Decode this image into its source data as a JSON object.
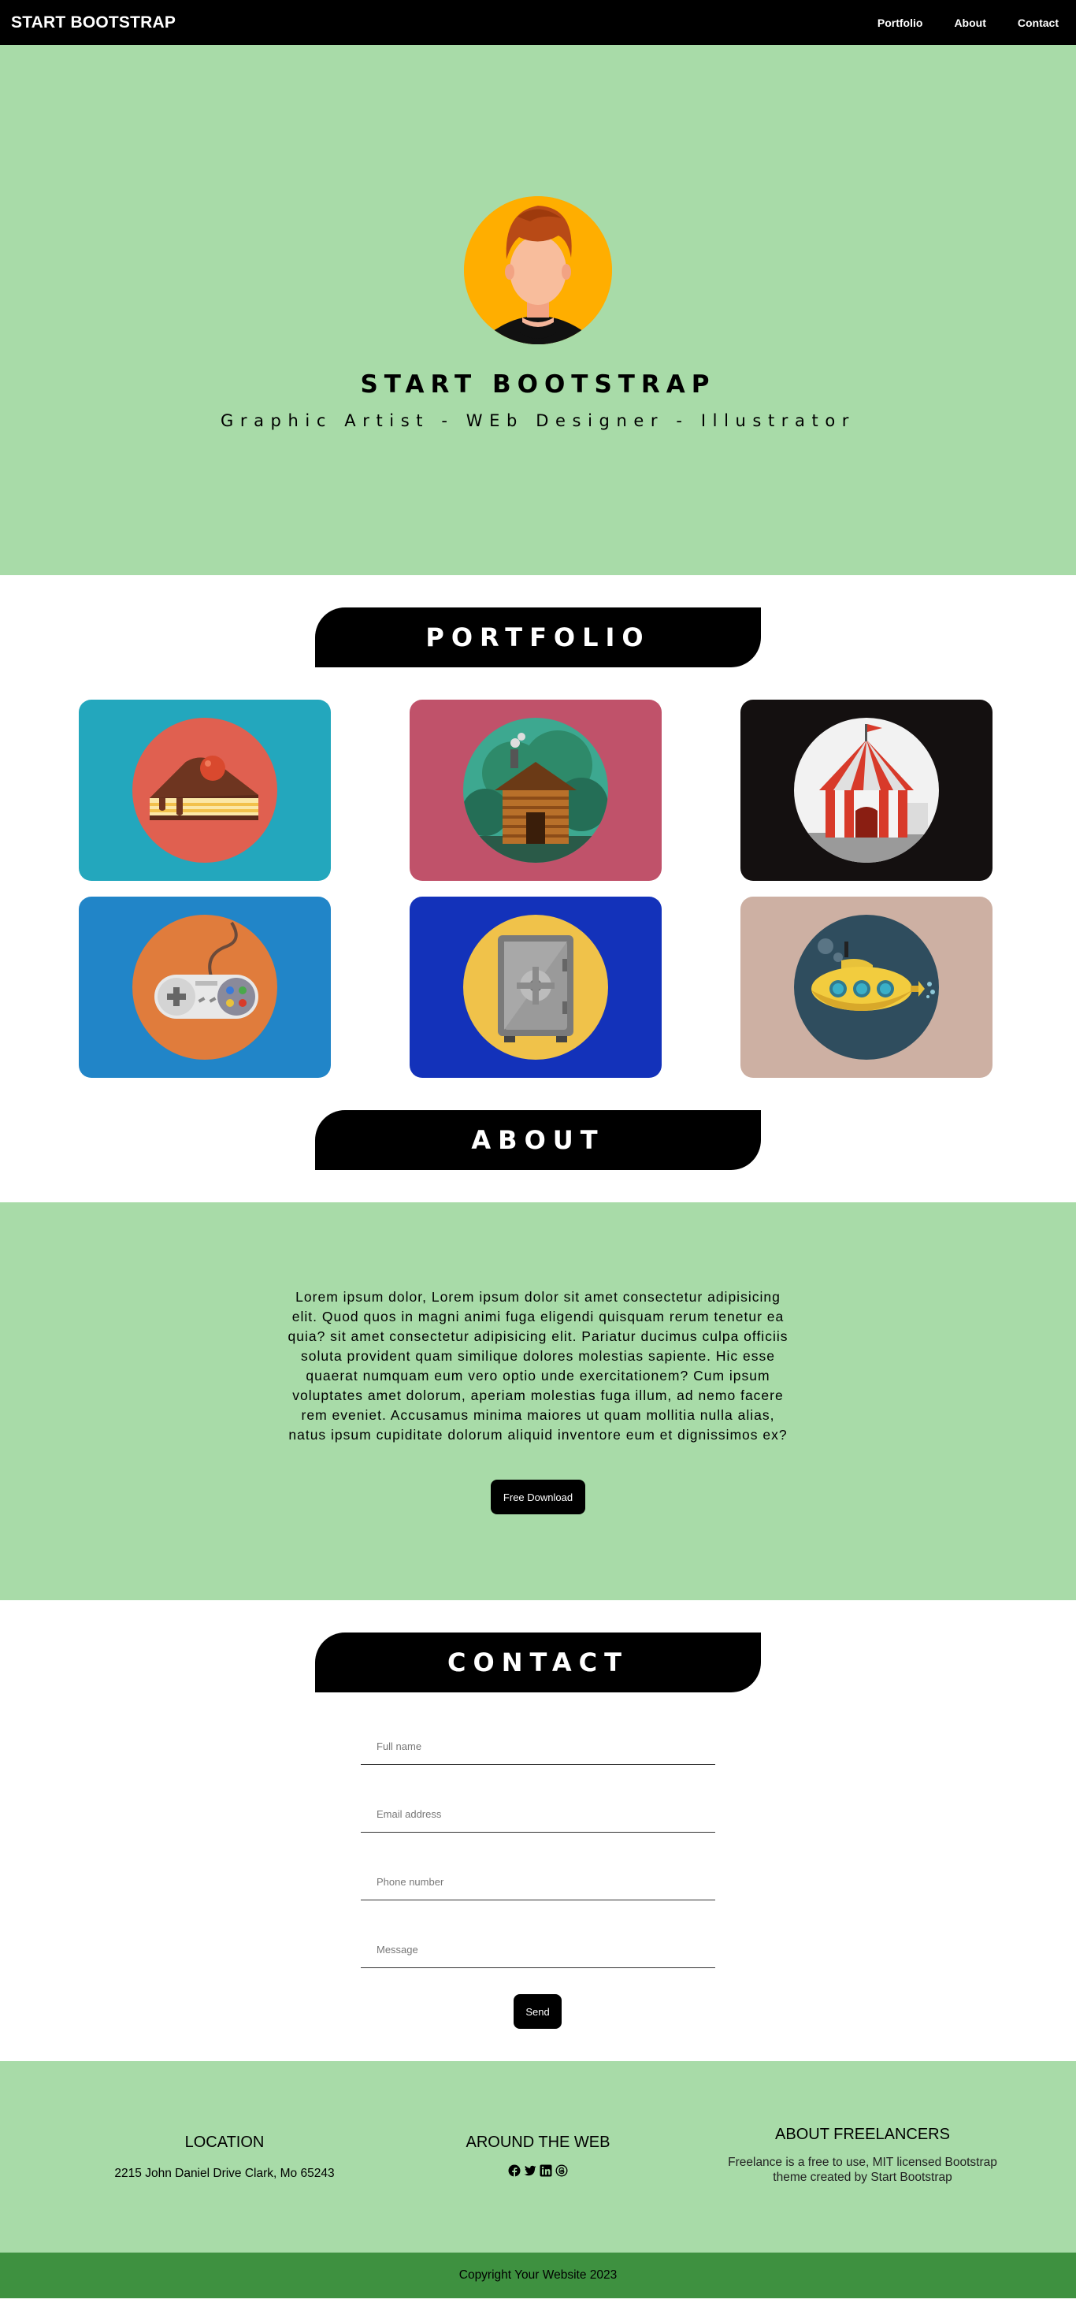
{
  "nav": {
    "brand": "START BOOTSTRAP",
    "links": [
      "Portfolio",
      "About",
      "Contact"
    ]
  },
  "hero": {
    "title": "START BOOTSTRAP",
    "subtitle": "Graphic Artist - WEb Designer - Illustrator"
  },
  "portfolio": {
    "heading": "PORTFOLIO",
    "items": [
      {
        "icon": "cake-icon",
        "bg": "#23a7bd",
        "circle": "#e06050"
      },
      {
        "icon": "cabin-icon",
        "bg": "#c0526a",
        "circle": "#3da890"
      },
      {
        "icon": "circus-tent-icon",
        "bg": "#141010",
        "circle": "#f2f2f2"
      },
      {
        "icon": "game-controller-icon",
        "bg": "#2185c8",
        "circle": "#e07c3c"
      },
      {
        "icon": "safe-icon",
        "bg": "#1332ba",
        "circle": "#f0c24a"
      },
      {
        "icon": "submarine-icon",
        "bg": "#cdb0a3",
        "circle": "#2f4d5e"
      }
    ]
  },
  "about": {
    "heading": "ABOUT",
    "text": "Lorem ipsum dolor, Lorem ipsum dolor sit amet consectetur adipisicing elit. Quod quos in magni animi fuga eligendi quisquam rerum tenetur ea quia? sit amet consectetur adipisicing elit. Pariatur ducimus culpa officiis soluta provident quam similique dolores molestias sapiente. Hic esse quaerat numquam eum vero optio unde exercitationem? Cum ipsum voluptates amet dolorum, aperiam molestias fuga illum, ad nemo facere rem eveniet. Accusamus minima maiores ut quam mollitia nulla alias, natus ipsum cupiditate dolorum aliquid inventore eum et dignissimos ex?",
    "button": "Free Download"
  },
  "contact": {
    "heading": "CONTACT",
    "fields": [
      {
        "placeholder": "Full name",
        "value": ""
      },
      {
        "placeholder": "Email address",
        "value": ""
      },
      {
        "placeholder": "Phone number",
        "value": ""
      },
      {
        "placeholder": "Message",
        "value": ""
      }
    ],
    "button": "Send"
  },
  "footer": {
    "location": {
      "heading": "LOCATION",
      "text": "2215 John Daniel Drive Clark, Mo 65243"
    },
    "web": {
      "heading": "AROUND THE WEB",
      "icons": [
        "facebook-icon",
        "twitter-icon",
        "linkedin-icon",
        "threads-icon"
      ]
    },
    "about": {
      "heading": "ABOUT FREELANCERS",
      "text": "Freelance is a free to use, MIT licensed Bootstrap theme created by Start Bootstrap"
    },
    "copyright": "Copyright Your Website 2023"
  },
  "colors": {
    "accent_green": "#a8dba8",
    "footer_dark_green": "#3e9140",
    "black": "#000000"
  }
}
